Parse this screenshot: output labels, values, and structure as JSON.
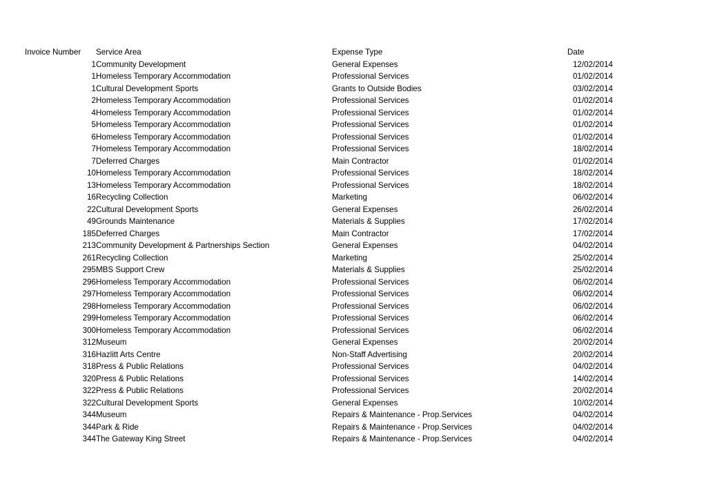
{
  "table": {
    "columns": [
      {
        "key": "invoice_number",
        "label": "Invoice Number"
      },
      {
        "key": "service_area",
        "label": "Service Area"
      },
      {
        "key": "expense_type",
        "label": "Expense Type"
      },
      {
        "key": "date",
        "label": "Date"
      }
    ],
    "rows": [
      {
        "invoice_number": "1",
        "service_area": "Community Development",
        "expense_type": "General Expenses",
        "date": "12/02/2014"
      },
      {
        "invoice_number": "1",
        "service_area": "Homeless Temporary Accommodation",
        "expense_type": "Professional Services",
        "date": "01/02/2014"
      },
      {
        "invoice_number": "1",
        "service_area": "Cultural Development Sports",
        "expense_type": "Grants to Outside Bodies",
        "date": "03/02/2014"
      },
      {
        "invoice_number": "2",
        "service_area": "Homeless Temporary Accommodation",
        "expense_type": "Professional Services",
        "date": "01/02/2014"
      },
      {
        "invoice_number": "4",
        "service_area": "Homeless Temporary Accommodation",
        "expense_type": "Professional Services",
        "date": "01/02/2014"
      },
      {
        "invoice_number": "5",
        "service_area": "Homeless Temporary Accommodation",
        "expense_type": "Professional Services",
        "date": "01/02/2014"
      },
      {
        "invoice_number": "6",
        "service_area": "Homeless Temporary Accommodation",
        "expense_type": "Professional Services",
        "date": "01/02/2014"
      },
      {
        "invoice_number": "7",
        "service_area": "Homeless Temporary Accommodation",
        "expense_type": "Professional Services",
        "date": "18/02/2014"
      },
      {
        "invoice_number": "7",
        "service_area": "Deferred Charges",
        "expense_type": "Main Contractor",
        "date": "01/02/2014"
      },
      {
        "invoice_number": "10",
        "service_area": "Homeless Temporary Accommodation",
        "expense_type": "Professional Services",
        "date": "18/02/2014"
      },
      {
        "invoice_number": "13",
        "service_area": "Homeless Temporary Accommodation",
        "expense_type": "Professional Services",
        "date": "18/02/2014"
      },
      {
        "invoice_number": "16",
        "service_area": "Recycling Collection",
        "expense_type": "Marketing",
        "date": "06/02/2014"
      },
      {
        "invoice_number": "22",
        "service_area": "Cultural Development Sports",
        "expense_type": "General Expenses",
        "date": "26/02/2014"
      },
      {
        "invoice_number": "49",
        "service_area": "Grounds Maintenance",
        "expense_type": "Materials & Supplies",
        "date": "17/02/2014"
      },
      {
        "invoice_number": "185",
        "service_area": "Deferred Charges",
        "expense_type": "Main Contractor",
        "date": "17/02/2014"
      },
      {
        "invoice_number": "213",
        "service_area": "Community Development & Partnerships Section",
        "expense_type": "General Expenses",
        "date": "04/02/2014"
      },
      {
        "invoice_number": "261",
        "service_area": "Recycling Collection",
        "expense_type": "Marketing",
        "date": "25/02/2014"
      },
      {
        "invoice_number": "295",
        "service_area": "MBS Support Crew",
        "expense_type": "Materials & Supplies",
        "date": "25/02/2014"
      },
      {
        "invoice_number": "296",
        "service_area": "Homeless Temporary Accommodation",
        "expense_type": "Professional Services",
        "date": "06/02/2014"
      },
      {
        "invoice_number": "297",
        "service_area": "Homeless Temporary Accommodation",
        "expense_type": "Professional Services",
        "date": "06/02/2014"
      },
      {
        "invoice_number": "298",
        "service_area": "Homeless Temporary Accommodation",
        "expense_type": "Professional Services",
        "date": "06/02/2014"
      },
      {
        "invoice_number": "299",
        "service_area": "Homeless Temporary Accommodation",
        "expense_type": "Professional Services",
        "date": "06/02/2014"
      },
      {
        "invoice_number": "300",
        "service_area": "Homeless Temporary Accommodation",
        "expense_type": "Professional Services",
        "date": "06/02/2014"
      },
      {
        "invoice_number": "312",
        "service_area": "Museum",
        "expense_type": "General Expenses",
        "date": "20/02/2014"
      },
      {
        "invoice_number": "316",
        "service_area": "Hazlitt Arts Centre",
        "expense_type": "Non-Staff Advertising",
        "date": "20/02/2014"
      },
      {
        "invoice_number": "318",
        "service_area": "Press & Public Relations",
        "expense_type": "Professional Services",
        "date": "04/02/2014"
      },
      {
        "invoice_number": "320",
        "service_area": "Press & Public Relations",
        "expense_type": "Professional Services",
        "date": "14/02/2014"
      },
      {
        "invoice_number": "322",
        "service_area": "Press & Public Relations",
        "expense_type": "Professional Services",
        "date": "20/02/2014"
      },
      {
        "invoice_number": "322",
        "service_area": "Cultural Development Sports",
        "expense_type": "General Expenses",
        "date": "10/02/2014"
      },
      {
        "invoice_number": "344",
        "service_area": "Museum",
        "expense_type": "Repairs & Maintenance - Prop.Services",
        "date": "04/02/2014"
      },
      {
        "invoice_number": "344",
        "service_area": "Park & Ride",
        "expense_type": "Repairs & Maintenance - Prop.Services",
        "date": "04/02/2014"
      },
      {
        "invoice_number": "344",
        "service_area": "The Gateway King Street",
        "expense_type": "Repairs & Maintenance - Prop.Services",
        "date": "04/02/2014"
      }
    ]
  }
}
